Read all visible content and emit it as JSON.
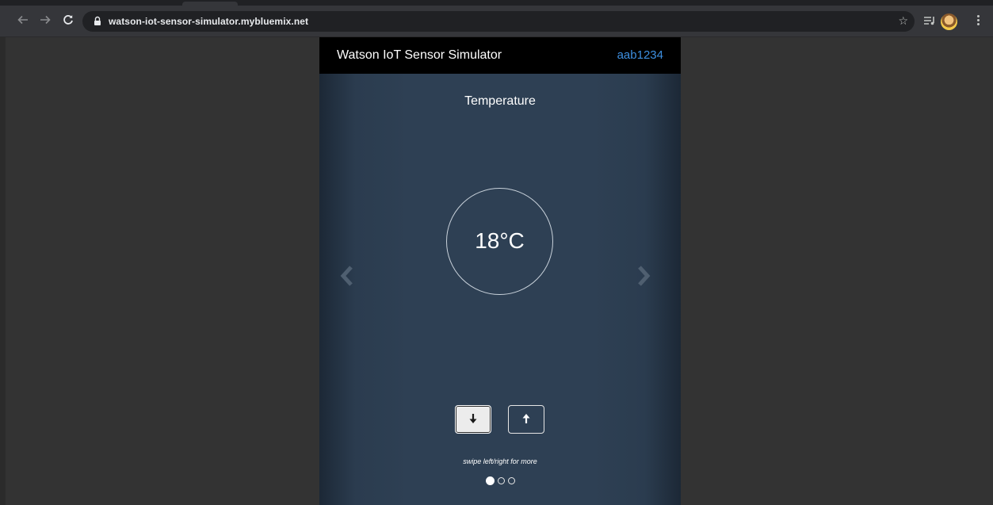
{
  "browser": {
    "url": "watson-iot-sensor-simulator.mybluemix.net",
    "icons": {
      "back": "back-arrow-icon",
      "forward": "forward-arrow-icon",
      "reload": "reload-icon",
      "lock": "lock-icon",
      "bookmark": "star-icon",
      "media": "media-queue-icon",
      "profile": "avatar",
      "menu": "kebab-menu-icon"
    }
  },
  "app": {
    "title": "Watson IoT Sensor Simulator",
    "user_id": "aab1234",
    "user_color": "#3d8fe0",
    "sensor": {
      "name": "Temperature",
      "value": "18°C"
    },
    "controls": {
      "decrease": "down-arrow-icon",
      "increase": "up-arrow-icon",
      "prev": "chevron-left-icon",
      "next": "chevron-right-icon"
    },
    "hint": "swipe left/right for more",
    "pagination": {
      "current": 1,
      "total": 3
    }
  }
}
